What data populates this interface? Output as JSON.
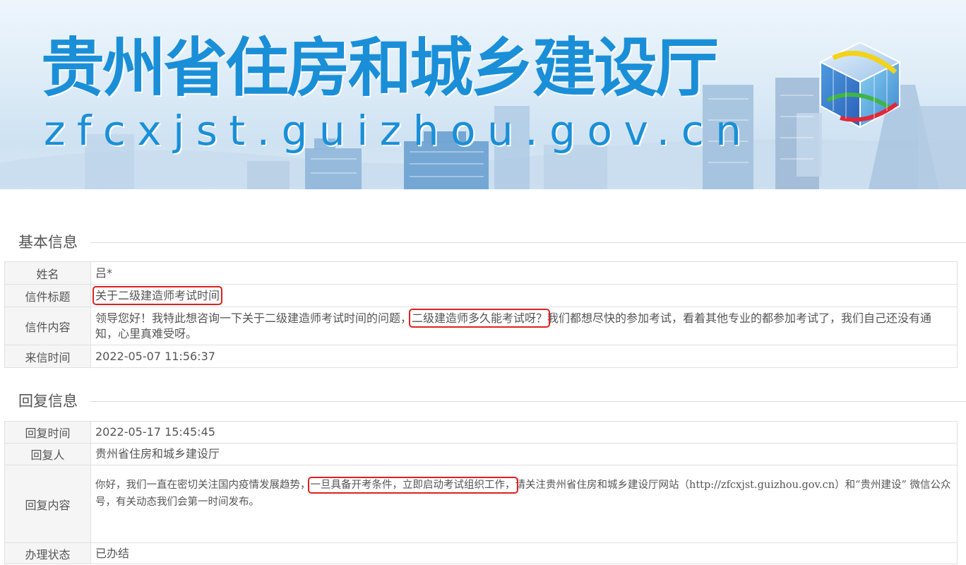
{
  "banner": {
    "title": "贵州省住房和城乡建设厅",
    "domain": "zfcxjst.guizhou.gov.cn"
  },
  "basic": {
    "heading": "基本信息",
    "name_label": "姓名",
    "name_value": "吕*",
    "subject_label": "信件标题",
    "subject_value": "关于二级建造师考试时间",
    "content_label": "信件内容",
    "content_part1": "领导您好！我特此想咨询一下关于二级建造师考试时间的问题，",
    "content_highlight": "二级建造师多久能考试呀？",
    "content_part2": "我们都想尽快的参加考试，看着其他专业的都参加考试了，我们自己还没有通知，心里真难受呀。",
    "time_label": "来信时间",
    "time_value": "2022-05-07 11:56:37"
  },
  "reply": {
    "heading": "回复信息",
    "time_label": "回复时间",
    "time_value": "2022-05-17 15:45:45",
    "replier_label": "回复人",
    "replier_value": "贵州省住房和城乡建设厅",
    "content_label": "回复内容",
    "content_part1": "你好，我们一直在密切关注国内疫情发展趋势，",
    "content_highlight": "一旦具备开考条件，立即启动考试组织工作，",
    "content_part2": "请关注贵州省住房和城乡建设厅网站（http://zfcxjst.guizhou.gov.cn）和“贵州建设” 微信公众号，有关动态我们会第一时间发布。",
    "status_label": "办理状态",
    "status_value": "已办结"
  },
  "colors": {
    "banner_text": "#1a8fd8",
    "highlight_box": "#e02020"
  }
}
